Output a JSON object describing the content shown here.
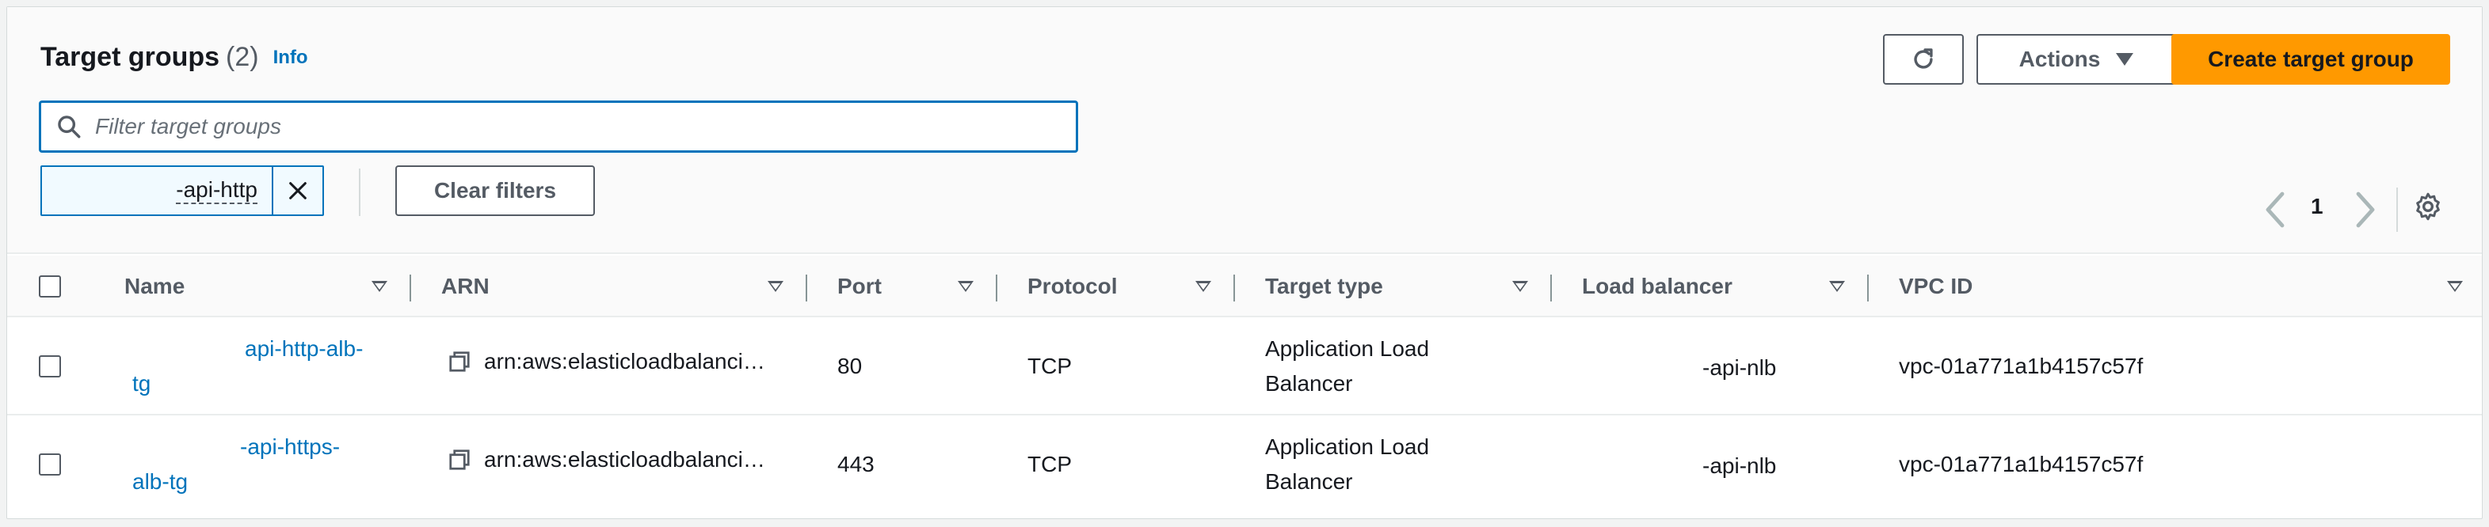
{
  "header": {
    "title": "Target groups",
    "count": "(2)",
    "info_label": "Info",
    "actions_label": "Actions",
    "create_label": "Create target group"
  },
  "search": {
    "placeholder": "Filter target groups"
  },
  "filter_token": {
    "label": "-api-http"
  },
  "clear_filters_label": "Clear filters",
  "pagination": {
    "current_page": "1"
  },
  "table": {
    "columns": [
      "Name",
      "ARN",
      "Port",
      "Protocol",
      "Target type",
      "Load balancer",
      "VPC ID"
    ],
    "rows": [
      {
        "name_line1": "api-http-alb-",
        "name_line2": "tg",
        "arn": "arn:aws:elasticloadbalanci…",
        "port": "80",
        "protocol": "TCP",
        "target_type_line1": "Application Load",
        "target_type_line2": "Balancer",
        "load_balancer": "-api-nlb",
        "vpc_id": "vpc-01a771a1b4157c57f"
      },
      {
        "name_line1": "-api-https-",
        "name_line2": "alb-tg",
        "arn": "arn:aws:elasticloadbalanci…",
        "port": "443",
        "protocol": "TCP",
        "target_type_line1": "Application Load",
        "target_type_line2": "Balancer",
        "load_balancer": "-api-nlb",
        "vpc_id": "vpc-01a771a1b4157c57f"
      }
    ]
  },
  "colors": {
    "primary_button": "#ff9900",
    "link": "#0073bb",
    "border": "#545b64"
  }
}
